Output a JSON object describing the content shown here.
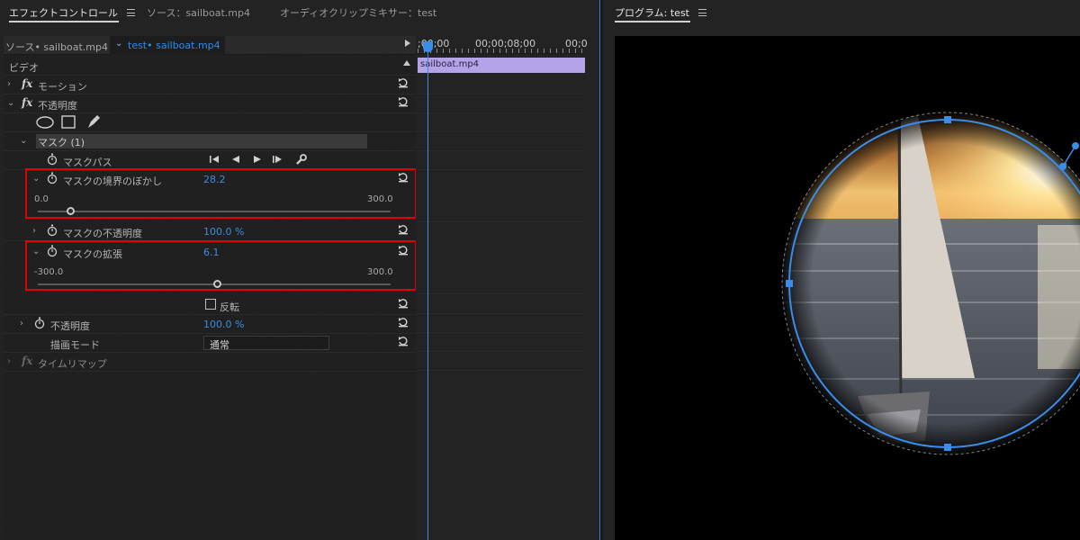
{
  "tabs": {
    "effect_controls": "エフェクトコントロール",
    "source": "ソース：sailboat.mp4",
    "audio_mixer": "オーディオクリップミキサー：test",
    "program": "プログラム: test"
  },
  "ec_header": {
    "source_clip": "ソース• sailboat.mp4",
    "sequence_clip": "test• sailboat.mp4"
  },
  "sections": {
    "video": "ビデオ",
    "motion": "モーション",
    "opacity": "不透明度",
    "time_remap": "タイムリマップ"
  },
  "mask": {
    "name": "マスク (1)",
    "path": "マスクパス",
    "feather_label": "マスクの境界のぼかし",
    "feather_value": "28.2",
    "feather_min": "0.0",
    "feather_max": "300.0",
    "feather_fraction": 0.094,
    "opacity_label": "マスクの不透明度",
    "opacity_value": "100.0 %",
    "expansion_label": "マスクの拡張",
    "expansion_value": "6.1",
    "expansion_min": "-300.0",
    "expansion_max": "300.0",
    "expansion_fraction": 0.51,
    "invert_label": "反転"
  },
  "opacity": {
    "label": "不透明度",
    "value": "100.0 %",
    "blend_label": "描画モード",
    "blend_value": "通常"
  },
  "timeline": {
    "time_start": ";00;00",
    "time_mid": "00;00;08;00",
    "time_end": "00;0",
    "clip_name": "sailboat.mp4"
  },
  "colors": {
    "accent_blue": "#2d8ceb",
    "highlight_red": "#e00000",
    "clip_purple": "#b5a3e8"
  }
}
